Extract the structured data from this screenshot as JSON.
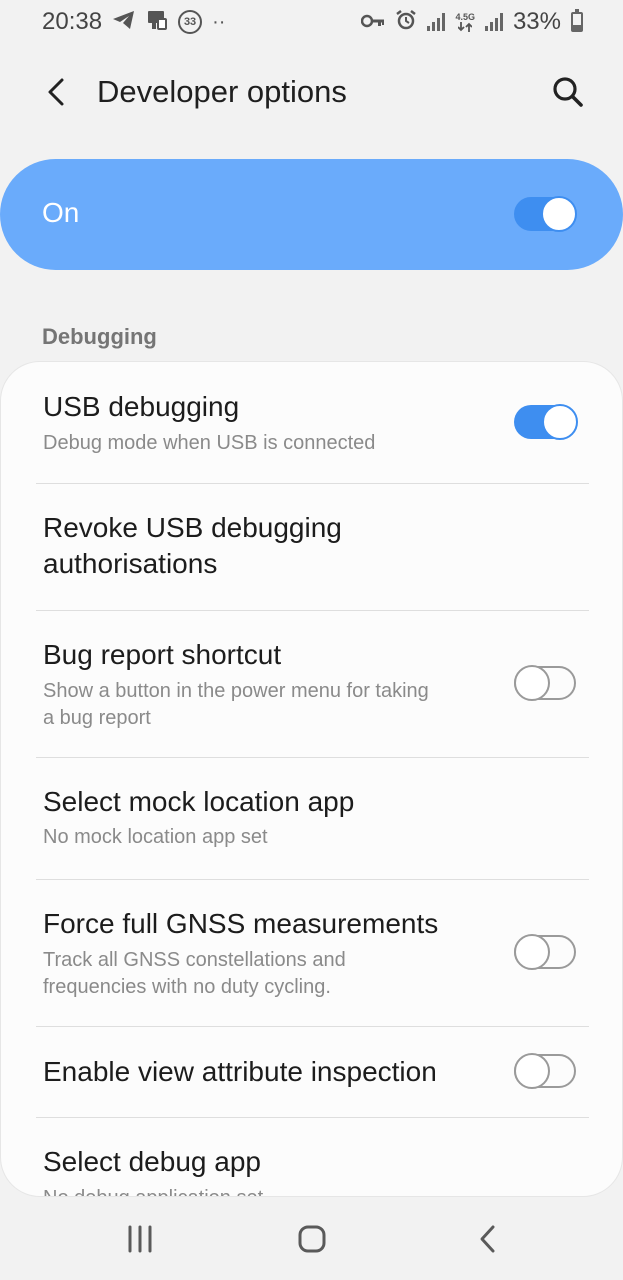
{
  "status_bar": {
    "time": "20:38",
    "left_icons": [
      "telegram-icon",
      "notification-icon",
      "circle-33-icon",
      "more-dots-icon"
    ],
    "badge_number": "33",
    "more_dots": "··",
    "network_label": "4.5G",
    "battery_percent": "33%",
    "battery_level": 0.33
  },
  "header": {
    "title": "Developer options"
  },
  "master_switch": {
    "label": "On",
    "enabled": true,
    "color": "#6aabfb"
  },
  "section": {
    "label": "Debugging"
  },
  "items": [
    {
      "title": "USB debugging",
      "subtitle": "Debug mode when USB is connected",
      "toggle": "on"
    },
    {
      "title_line1": "Revoke USB debugging",
      "title_line2": "authorisations"
    },
    {
      "title": "Bug report shortcut",
      "subtitle_line1": "Show a button in the power menu for taking",
      "subtitle_line2": "a bug report",
      "toggle": "off"
    },
    {
      "title": "Select mock location app",
      "subtitle": "No mock location app set"
    },
    {
      "title": "Force full GNSS measurements",
      "subtitle_line1": "Track all GNSS constellations and",
      "subtitle_line2": "frequencies with no duty cycling.",
      "toggle": "off"
    },
    {
      "title": "Enable view attribute inspection",
      "toggle": "off"
    },
    {
      "title": "Select debug app",
      "subtitle": "No debug application set"
    }
  ],
  "colors": {
    "accent": "#3e8ef0",
    "background": "#f2f2f2",
    "card": "#fcfcfc"
  }
}
